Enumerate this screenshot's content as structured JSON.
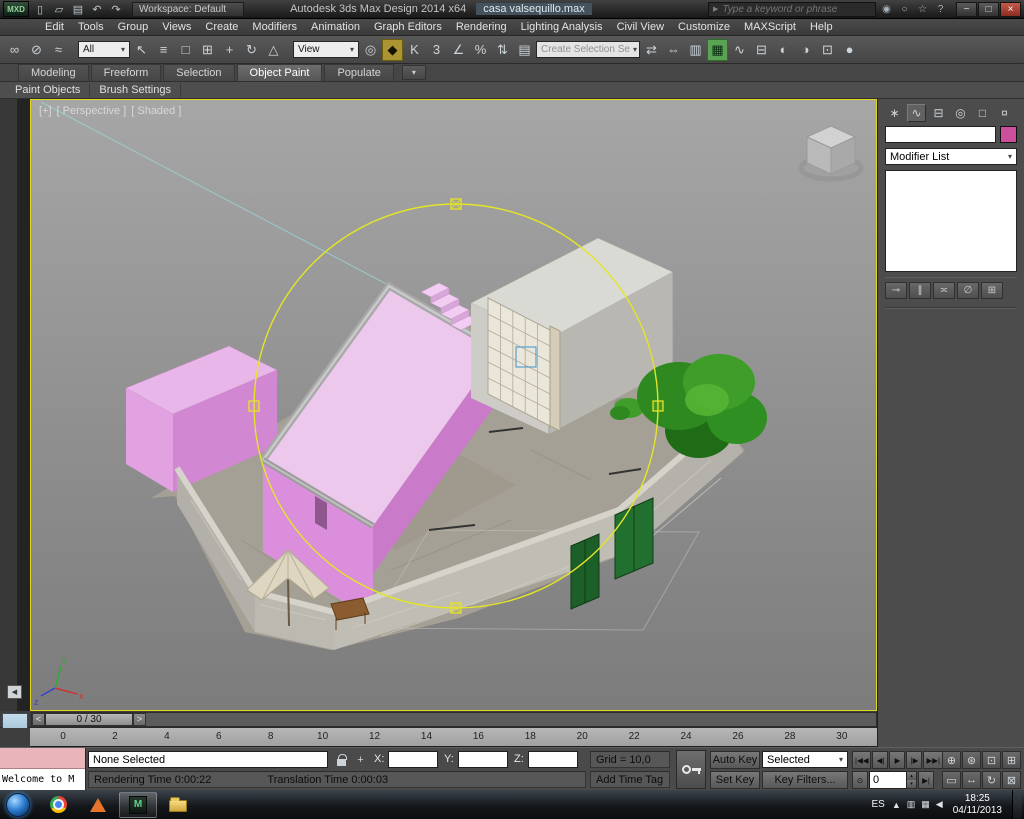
{
  "ui": {
    "caret": "▾",
    "up": "▴",
    "down": "▾",
    "plus": "+",
    "left_small": "◀"
  },
  "titlebar": {
    "logo_text": "MXD",
    "quick_icons": [
      {
        "name": "new-scene-icon",
        "glyph": "▯"
      },
      {
        "name": "open-file-icon",
        "glyph": "▱"
      },
      {
        "name": "save-file-icon",
        "glyph": "▤"
      },
      {
        "name": "undo-icon",
        "glyph": "↶"
      },
      {
        "name": "redo-icon",
        "glyph": "↷"
      }
    ],
    "workspace_label": "Workspace: Default",
    "app_title": "Autodesk 3ds Max Design 2014 x64",
    "doc_title": "casa valsequillo.max",
    "search_prefix": "▶",
    "search_placeholder": "Type a keyword or phrase",
    "title_icons": [
      {
        "name": "communication-center-icon",
        "glyph": "◉"
      },
      {
        "name": "sign-in-icon",
        "glyph": "○"
      },
      {
        "name": "favorites-icon",
        "glyph": "☆"
      },
      {
        "name": "help-icon",
        "glyph": "?"
      }
    ],
    "window_buttons": [
      {
        "name": "minimize-button",
        "glyph": "−"
      },
      {
        "name": "maximize-button",
        "glyph": "□"
      },
      {
        "name": "close-button",
        "glyph": "×",
        "cls": "close"
      }
    ]
  },
  "menubar": {
    "items": [
      "Edit",
      "Tools",
      "Group",
      "Views",
      "Create",
      "Modifiers",
      "Animation",
      "Graph Editors",
      "Rendering",
      "Lighting Analysis",
      "Civil View",
      "Customize",
      "MAXScript",
      "Help"
    ]
  },
  "toolbar": {
    "group1": [
      {
        "name": "select-and-link-icon",
        "glyph": "∞"
      },
      {
        "name": "unlink-selection-icon",
        "glyph": "⊘"
      },
      {
        "name": "bind-to-space-warp-icon",
        "glyph": "≈"
      }
    ],
    "filter_value": "All",
    "group2": [
      {
        "name": "select-object-icon",
        "glyph": "↖"
      },
      {
        "name": "select-by-name-icon",
        "glyph": "≡"
      },
      {
        "name": "selection-region-icon",
        "glyph": "□"
      },
      {
        "name": "window-crossing-icon",
        "glyph": "⊞"
      },
      {
        "name": "select-and-move-icon",
        "glyph": "+"
      },
      {
        "name": "select-and-rotate-icon",
        "glyph": "↻"
      },
      {
        "name": "select-and-scale-icon",
        "glyph": "△"
      }
    ],
    "coord_value": "View",
    "group3": [
      {
        "name": "use-pivot-center-icon",
        "glyph": "◎"
      },
      {
        "name": "select-and-manipulate-icon",
        "glyph": "◆",
        "cls": "on-y"
      },
      {
        "name": "keyboard-override-icon",
        "glyph": "K"
      },
      {
        "name": "snaps-toggle-icon",
        "glyph": "3"
      },
      {
        "name": "angle-snap-icon",
        "glyph": "∠"
      },
      {
        "name": "percent-snap-icon",
        "glyph": "%"
      },
      {
        "name": "spinner-snap-icon",
        "glyph": "⇅"
      },
      {
        "name": "edit-named-selection-sets-icon",
        "glyph": "▤"
      }
    ],
    "combo_value": "Create Selection Se",
    "group4": [
      {
        "name": "mirror-icon",
        "glyph": "⇄"
      },
      {
        "name": "align-icon",
        "glyph": "⇔"
      },
      {
        "name": "layer-manager-icon",
        "glyph": "▥"
      },
      {
        "name": "toggle-ribbon-icon",
        "glyph": "▦",
        "cls": "on-g"
      },
      {
        "name": "curve-editor-icon",
        "glyph": "∿"
      },
      {
        "name": "schematic-view-icon",
        "glyph": "⊟"
      },
      {
        "name": "material-editor-icon",
        "glyph": "◐"
      },
      {
        "name": "render-setup-icon",
        "glyph": "◑"
      },
      {
        "name": "rendered-frame-icon",
        "glyph": "⊡"
      },
      {
        "name": "render-production-icon",
        "glyph": "●"
      }
    ]
  },
  "ribbon": {
    "tabs": [
      {
        "name": "ribbon-tab-modeling",
        "label": "Modeling"
      },
      {
        "name": "ribbon-tab-freeform",
        "label": "Freeform"
      },
      {
        "name": "ribbon-tab-selection",
        "label": "Selection"
      },
      {
        "name": "ribbon-tab-object-paint",
        "label": "Object Paint",
        "cls": "on"
      },
      {
        "name": "ribbon-tab-populate",
        "label": "Populate"
      }
    ],
    "overflow_glyph": "▾",
    "subtabs": [
      {
        "name": "subtab-paint-objects",
        "label": "Paint Objects"
      },
      {
        "name": "subtab-brush-settings",
        "label": "Brush Settings"
      }
    ]
  },
  "viewport": {
    "labels": [
      {
        "name": "viewport-menu-general",
        "label": "[+]"
      },
      {
        "name": "viewport-menu-pov",
        "label": "[ Perspective ]"
      },
      {
        "name": "viewport-menu-shading",
        "label": "[ Shaded ]"
      }
    ]
  },
  "command_panel": {
    "tabs": [
      {
        "name": "create-tab-icon",
        "glyph": "∗"
      },
      {
        "name": "modify-tab-icon",
        "glyph": "∿",
        "cls": "on"
      },
      {
        "name": "hierarchy-tab-icon",
        "glyph": "⊟"
      },
      {
        "name": "motion-tab-icon",
        "glyph": "◎"
      },
      {
        "name": "display-tab-icon",
        "glyph": "□"
      },
      {
        "name": "utilities-tab-icon",
        "glyph": "¤"
      }
    ],
    "swatch_color": "#cc4f9e",
    "modifier_list_label": "Modifier List",
    "stack_buttons": [
      {
        "name": "pin-stack-button",
        "glyph": "⊸"
      },
      {
        "name": "show-end-result-button",
        "glyph": "∥"
      },
      {
        "name": "make-unique-button",
        "glyph": "≍"
      },
      {
        "name": "remove-modifier-button",
        "glyph": "∅"
      },
      {
        "name": "configure-modifier-sets-button",
        "glyph": "⊞"
      }
    ]
  },
  "timeline": {
    "handle_label": "0 / 30",
    "step_back": "<",
    "step_forward": ">"
  },
  "trackbar": {
    "ticks": [
      "0",
      "2",
      "4",
      "6",
      "8",
      "10",
      "12",
      "14",
      "16",
      "18",
      "20",
      "22",
      "24",
      "26",
      "28",
      "30"
    ]
  },
  "statusbar": {
    "listener_text": "Welcome to M",
    "selection_status": "None Selected",
    "x_label": "X:",
    "y_label": "Y:",
    "z_label": "Z:",
    "grid_text": "Grid = 10,0",
    "prompt_left": "Rendering Time 0:00:22",
    "prompt_right": "Translation Time 0:00:03",
    "add_time_tag": "Add Time Tag",
    "auto_key_label": "Auto Key",
    "set_key_label": "Set Key",
    "key_mode_value": "Selected",
    "key_filters_label": "Key Filters...",
    "frame_value": "0",
    "key_mode_toggle_glyph": "⊙",
    "next_key_glyph": "▶|",
    "time_controls": [
      {
        "name": "go-to-start-button",
        "glyph": "|◀◀"
      },
      {
        "name": "previous-frame-button",
        "glyph": "◀|"
      },
      {
        "name": "play-button",
        "glyph": "▶"
      },
      {
        "name": "next-frame-button",
        "glyph": "|▶"
      },
      {
        "name": "go-to-end-button",
        "glyph": "▶▶|"
      }
    ],
    "nav_row1": [
      {
        "name": "zoom-icon",
        "glyph": "⊕"
      },
      {
        "name": "zoom-all-icon",
        "glyph": "⊛"
      },
      {
        "name": "zoom-extents-icon",
        "glyph": "⊡"
      },
      {
        "name": "zoom-extents-all-icon",
        "glyph": "⊞"
      }
    ],
    "nav_row2": [
      {
        "name": "zoom-region-icon",
        "glyph": "▭"
      },
      {
        "name": "pan-icon",
        "glyph": "↔"
      },
      {
        "name": "orbit-icon",
        "glyph": "↻"
      },
      {
        "name": "maximize-viewport-icon",
        "glyph": "⊠"
      }
    ]
  },
  "taskbar": {
    "max_icon_text": "M",
    "tray_language": "ES",
    "tray_icons": [
      {
        "name": "tray-expand-icon",
        "glyph": "▲"
      },
      {
        "name": "action-center-icon",
        "glyph": "▥"
      },
      {
        "name": "network-icon",
        "glyph": "▦"
      },
      {
        "name": "volume-icon",
        "glyph": "◀"
      }
    ],
    "time": "18:25",
    "date": "04/11/2013"
  },
  "scene": {
    "viewport_border": "#e3d71e",
    "gizmo_color": "#e4e428",
    "building_pink": "#db8edb",
    "building_gray": "#cdccc6",
    "tree_green": "#2e8a20",
    "wall_gray": "#b2b0a8",
    "ground_color": "#a5a095",
    "guide_blue": "#9ad2d8",
    "axis_x": "x",
    "axis_y": "y",
    "axis_z": "z"
  }
}
